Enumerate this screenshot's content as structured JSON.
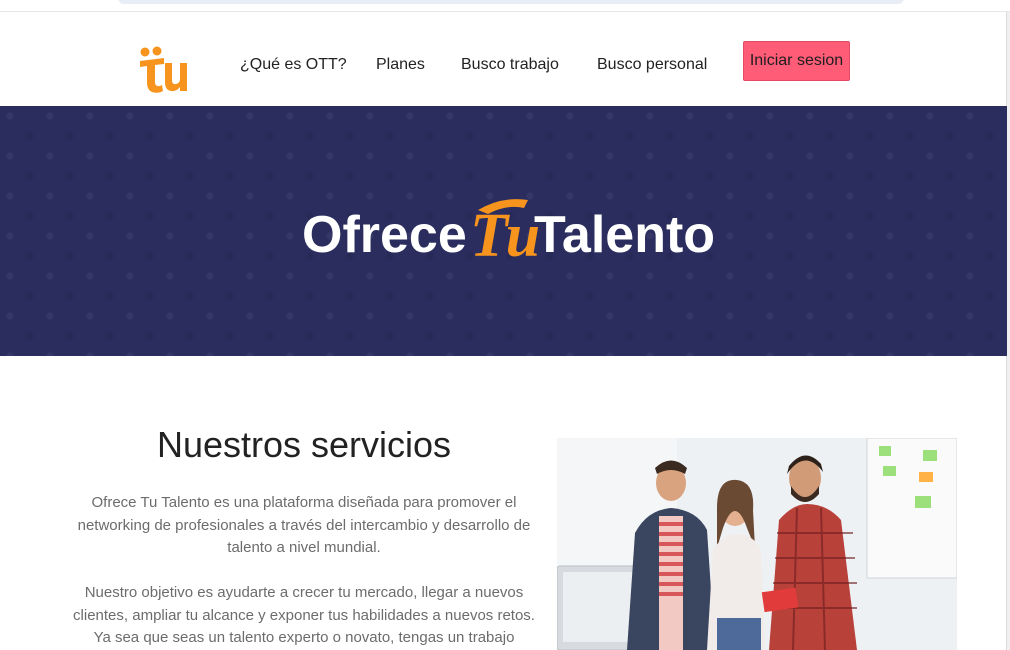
{
  "nav": {
    "items": [
      "¿Qué es OTT?",
      "Planes",
      "Busco trabajo",
      "Busco personal"
    ],
    "login_label": "Iniciar sesion",
    "brand_color": "#f7941d",
    "button_color": "#ff5c78"
  },
  "hero": {
    "brand_parts": [
      "Ofrece",
      "Tu",
      "Talento"
    ],
    "background_color": "#2a2d5e"
  },
  "services": {
    "title": "Nuestros servicios",
    "paragraph_1": "Ofrece Tu Talento es una plataforma diseñada para promover el networking de profesionales a través del intercambio y desarrollo de talento a nivel mundial.",
    "paragraph_2": "Nuestro objetivo es ayudarte a crecer tu mercado, llegar a nuevos clientes, ampliar tu alcance y exponer tus habilidades a nuevos retos. Ya sea que seas un talento experto o novato, tengas un trabajo"
  }
}
